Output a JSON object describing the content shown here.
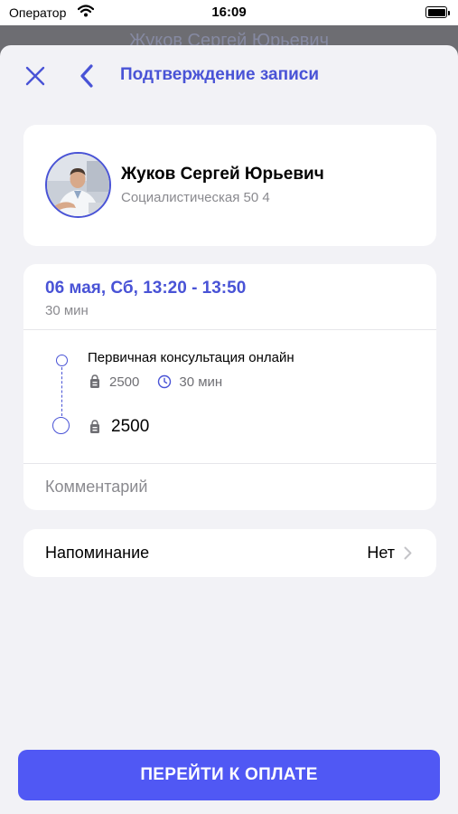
{
  "status_bar": {
    "carrier": "Оператор",
    "time": "16:09",
    "icons": [
      "wifi-icon",
      "battery-icon"
    ]
  },
  "background_title": "Жуков Сергей Юрьевич",
  "nav": {
    "title": "Подтверждение записи",
    "icons": [
      "close-icon",
      "chevron-left-icon"
    ]
  },
  "doctor": {
    "name": "Жуков Сергей Юрьевич",
    "address": "Социалистическая 50 4",
    "avatar_icon": "doctor-photo"
  },
  "booking": {
    "datetime": "06 мая, Сб, 13:20 - 13:50",
    "duration": "30 мин",
    "service": {
      "name": "Первичная консультация онлайн",
      "price": "2500",
      "duration": "30 мин"
    },
    "total": "2500",
    "comment_placeholder": "Комментарий"
  },
  "reminder": {
    "label": "Напоминание",
    "value": "Нет"
  },
  "pay_button": "ПЕРЕЙТИ К ОПЛАТЕ",
  "colors": {
    "accent": "#4953d6",
    "button": "#5058f4",
    "sheet_background": "#f2f2f6",
    "secondary_text": "#8a8a8f"
  }
}
